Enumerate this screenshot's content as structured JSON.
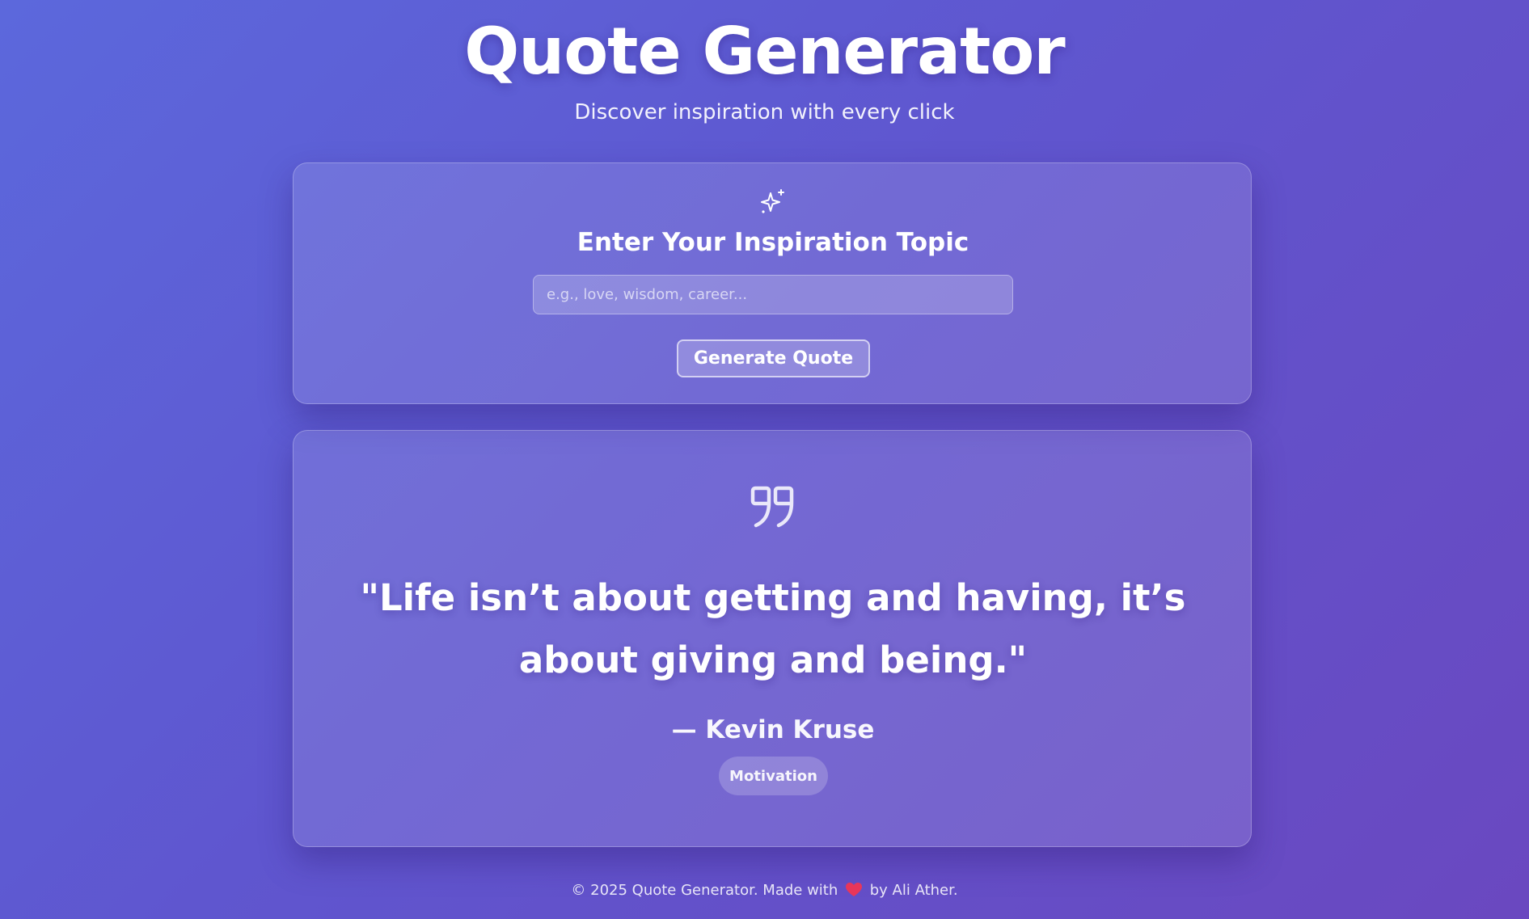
{
  "header": {
    "title": "Quote Generator",
    "subtitle": "Discover inspiration with every click"
  },
  "input_card": {
    "icon": "sparkle-icon",
    "heading": "Enter Your Inspiration Topic",
    "input_value": "",
    "input_placeholder": "e.g., love, wisdom, career...",
    "button_label": "Generate Quote"
  },
  "quote_card": {
    "icon": "quote-icon",
    "quote": "\"Life isn’t about getting and having, it’s about giving and being.\"",
    "author": "— Kevin Kruse",
    "category": "Motivation"
  },
  "footer": {
    "prefix": "© 2025 Quote Generator. Made with",
    "heart_icon": "heart-icon",
    "suffix": "by Ali Ather."
  },
  "colors": {
    "background_start": "#5c68dc",
    "background_end": "#6a48c0",
    "heart": "#e8365a"
  }
}
